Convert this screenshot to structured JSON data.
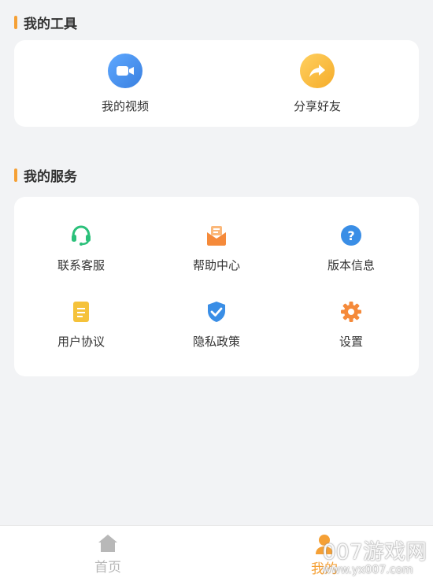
{
  "tools_section": {
    "title": "我的工具",
    "items": [
      {
        "label": "我的视频",
        "icon": "video-camera-icon",
        "color": "#4a90e2"
      },
      {
        "label": "分享好友",
        "icon": "share-arrow-icon",
        "color": "#f5b332"
      }
    ]
  },
  "services_section": {
    "title": "我的服务",
    "items": [
      {
        "label": "联系客服",
        "icon": "headset-icon",
        "color": "#2bc07a"
      },
      {
        "label": "帮助中心",
        "icon": "mail-help-icon",
        "color": "#f58a3a"
      },
      {
        "label": "版本信息",
        "icon": "question-circle-icon",
        "color": "#3a8ee6"
      },
      {
        "label": "用户协议",
        "icon": "document-icon",
        "color": "#f5c23a"
      },
      {
        "label": "隐私政策",
        "icon": "shield-check-icon",
        "color": "#3a8ee6"
      },
      {
        "label": "设置",
        "icon": "gear-icon",
        "color": "#f58a3a"
      }
    ]
  },
  "tabbar": {
    "tabs": [
      {
        "label": "首页",
        "icon": "home-icon",
        "active": false
      },
      {
        "label": "我的",
        "icon": "user-icon",
        "active": true
      }
    ],
    "active_color": "#f5a035",
    "inactive_color": "#b8b8b8"
  },
  "watermark": "007游戏网\nwww.yx007.com"
}
